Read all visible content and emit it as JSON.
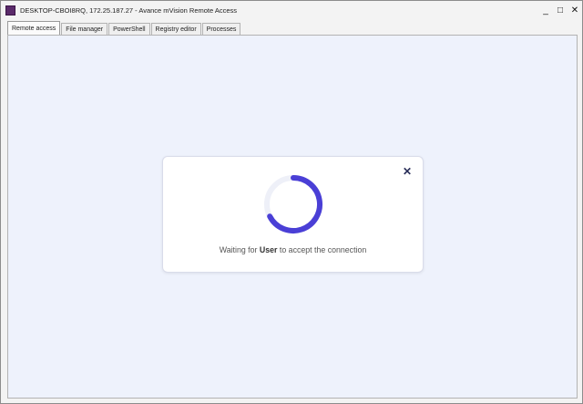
{
  "window": {
    "title": "DESKTOP-CBOI8RQ, 172.25.187.27 - Avance mVision Remote Access",
    "controls": {
      "minimize": "_",
      "maximize": "□",
      "close": "✕"
    }
  },
  "tabs": [
    {
      "label": "Remote access",
      "active": true
    },
    {
      "label": "File manager",
      "active": false
    },
    {
      "label": "PowerShell",
      "active": false
    },
    {
      "label": "Registry editor",
      "active": false
    },
    {
      "label": "Processes",
      "active": false
    }
  ],
  "dialog": {
    "close_icon": "✕",
    "message_prefix": "Waiting for ",
    "message_user": "User",
    "message_suffix": " to accept the connection",
    "spinner_color": "#4a3fd6",
    "spinner_track_color": "#eef0f8"
  }
}
